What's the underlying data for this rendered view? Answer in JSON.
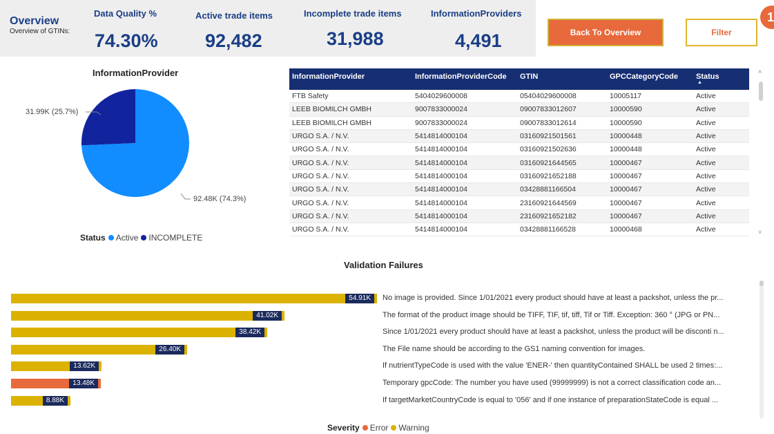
{
  "overview": {
    "title": "Overview",
    "subtitle": "Overview of GTINs:"
  },
  "kpis": [
    {
      "label": "Data Quality %",
      "value": "74.30%"
    },
    {
      "label": "Active trade items",
      "value": "92,482"
    },
    {
      "label": "Incomplete trade items",
      "value": "31,988"
    },
    {
      "label": "InformationProviders",
      "value": "4,491"
    }
  ],
  "buttons": {
    "back": "Back To Overview",
    "filter": "Filter",
    "badge": "1"
  },
  "pie": {
    "title": "InformationProvider",
    "label_incomplete": "31.99K (25.7%)",
    "label_active": "92.48K (74.3%)",
    "legend_title": "Status",
    "legend": [
      {
        "name": "Active",
        "color": "#118dff"
      },
      {
        "name": "INCOMPLETE",
        "color": "#12239e"
      }
    ],
    "chart_data": {
      "type": "pie",
      "title": "InformationProvider",
      "categories": [
        "Active",
        "INCOMPLETE"
      ],
      "values": [
        92.48,
        31.99
      ],
      "value_labels": [
        "92.48K (74.3%)",
        "31.99K (25.7%)"
      ],
      "legend_title": "Status",
      "legend_position": "bottom"
    }
  },
  "table": {
    "headers": [
      "InformationProvider",
      "InformationProviderCode",
      "GTIN",
      "GPCCategoryCode",
      "Status"
    ],
    "sorted_column": "Status",
    "rows": [
      [
        "FTB Safety",
        "5404029600008",
        "05404029600008",
        "10005117",
        "Active"
      ],
      [
        "LEEB BIOMILCH GMBH",
        "9007833000024",
        "09007833012607",
        "10000590",
        "Active"
      ],
      [
        "LEEB BIOMILCH GMBH",
        "9007833000024",
        "09007833012614",
        "10000590",
        "Active"
      ],
      [
        "URGO S.A. / N.V.",
        "5414814000104",
        "03160921501561",
        "10000448",
        "Active"
      ],
      [
        "URGO S.A. / N.V.",
        "5414814000104",
        "03160921502636",
        "10000448",
        "Active"
      ],
      [
        "URGO S.A. / N.V.",
        "5414814000104",
        "03160921644565",
        "10000467",
        "Active"
      ],
      [
        "URGO S.A. / N.V.",
        "5414814000104",
        "03160921652188",
        "10000467",
        "Active"
      ],
      [
        "URGO S.A. / N.V.",
        "5414814000104",
        "03428881166504",
        "10000467",
        "Active"
      ],
      [
        "URGO S.A. / N.V.",
        "5414814000104",
        "23160921644569",
        "10000467",
        "Active"
      ],
      [
        "URGO S.A. / N.V.",
        "5414814000104",
        "23160921652182",
        "10000467",
        "Active"
      ],
      [
        "URGO S.A. / N.V.",
        "5414814000104",
        "03428881166528",
        "10000468",
        "Active"
      ]
    ]
  },
  "validation": {
    "title": "Validation Failures",
    "legend_title": "Severity",
    "legend": [
      {
        "name": "Error",
        "color": "#e8693b"
      },
      {
        "name": "Warning",
        "color": "#dcb200"
      }
    ],
    "chart_data": {
      "type": "bar",
      "orientation": "horizontal",
      "title": "Validation Failures",
      "legend_title": "Severity",
      "legend_position": "bottom",
      "categories": [
        "No image is provided. Since 1/01/2021 every product should have at least a packshot, unless the pr...",
        "The format of the product image should be TIFF, TIF, tif, tiff, Tif or Tiff. Exception: 360 ° (JPG or PN...",
        "Since 1/01/2021 every product should have at least a packshot, unless the product will be disconti n...",
        "The File name should be according to the GS1 naming convention for images.",
        "If nutrientTypeCode is used with the value 'ENER-' then quantityContained SHALL be used 2 times:...",
        "Temporary gpcCode: The number you have used (99999999) is not a correct classification code an...",
        "If targetMarketCountryCode is equal to '056' and if one instance of preparationStateCode is equal ..."
      ],
      "values": [
        54910,
        41020,
        38420,
        26400,
        13620,
        13480,
        8880
      ],
      "value_labels": [
        "54.91K",
        "41.02K",
        "38.42K",
        "26.40K",
        "13.62K",
        "13.48K",
        "8.88K"
      ],
      "severity": [
        "Warning",
        "Warning",
        "Warning",
        "Warning",
        "Warning",
        "Error",
        "Warning"
      ],
      "xlim": [
        0,
        56000
      ]
    }
  }
}
